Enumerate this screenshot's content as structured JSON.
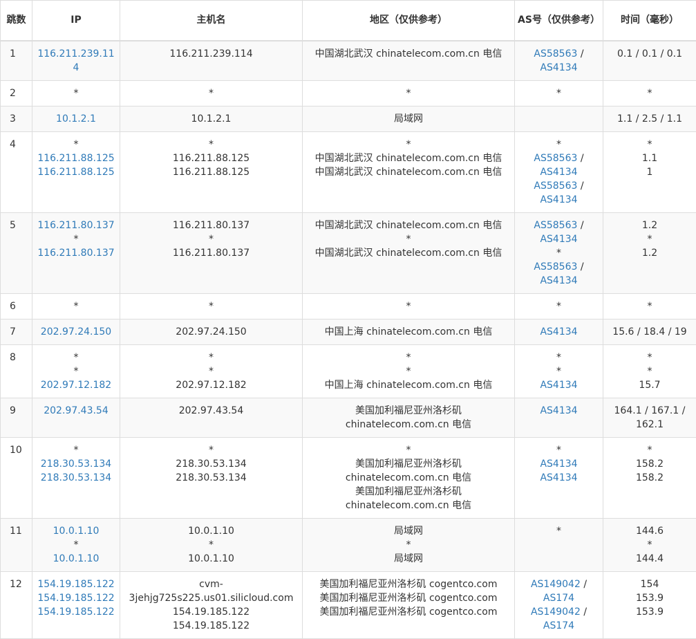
{
  "headers": [
    "跳数",
    "IP",
    "主机名",
    "地区（仅供参考）",
    "AS号（仅供参考）",
    "时间（毫秒）"
  ],
  "rows": [
    {
      "hop": "1",
      "ips": [
        "116.211.239.114"
      ],
      "hosts": [
        "116.211.239.114"
      ],
      "regions": [
        "中国湖北武汉 chinatelecom.com.cn 电信"
      ],
      "as": [
        [
          "AS58563",
          "AS4134"
        ]
      ],
      "times": [
        "0.1 / 0.1 / 0.1"
      ]
    },
    {
      "hop": "2",
      "ips": [
        "*"
      ],
      "hosts": [
        "*"
      ],
      "regions": [
        "*"
      ],
      "as": [
        [
          "*"
        ]
      ],
      "times": [
        "*"
      ]
    },
    {
      "hop": "3",
      "ips": [
        "10.1.2.1"
      ],
      "hosts": [
        "10.1.2.1"
      ],
      "regions": [
        "局域网"
      ],
      "as": [],
      "times": [
        "1.1 / 2.5 / 1.1"
      ]
    },
    {
      "hop": "4",
      "ips": [
        "*",
        "116.211.88.125",
        "116.211.88.125"
      ],
      "hosts": [
        "*",
        "116.211.88.125",
        "116.211.88.125"
      ],
      "regions": [
        "*",
        "中国湖北武汉 chinatelecom.com.cn 电信",
        "中国湖北武汉 chinatelecom.com.cn 电信"
      ],
      "as": [
        [
          "*"
        ],
        [
          "AS58563",
          "AS4134"
        ],
        [
          "AS58563",
          "AS4134"
        ]
      ],
      "times": [
        "*",
        "1.1",
        "1"
      ]
    },
    {
      "hop": "5",
      "ips": [
        "116.211.80.137",
        "*",
        "116.211.80.137"
      ],
      "hosts": [
        "116.211.80.137",
        "*",
        "116.211.80.137"
      ],
      "regions": [
        "中国湖北武汉 chinatelecom.com.cn 电信",
        "*",
        "中国湖北武汉 chinatelecom.com.cn 电信"
      ],
      "as": [
        [
          "AS58563",
          "AS4134"
        ],
        [
          "*"
        ],
        [
          "AS58563",
          "AS4134"
        ]
      ],
      "times": [
        "1.2",
        "*",
        "1.2"
      ]
    },
    {
      "hop": "6",
      "ips": [
        "*"
      ],
      "hosts": [
        "*"
      ],
      "regions": [
        "*"
      ],
      "as": [
        [
          "*"
        ]
      ],
      "times": [
        "*"
      ]
    },
    {
      "hop": "7",
      "ips": [
        "202.97.24.150"
      ],
      "hosts": [
        "202.97.24.150"
      ],
      "regions": [
        "中国上海 chinatelecom.com.cn 电信"
      ],
      "as": [
        [
          "AS4134"
        ]
      ],
      "times": [
        "15.6 / 18.4 / 19"
      ]
    },
    {
      "hop": "8",
      "ips": [
        "*",
        "*",
        "202.97.12.182"
      ],
      "hosts": [
        "*",
        "*",
        "202.97.12.182"
      ],
      "regions": [
        "*",
        "*",
        "中国上海 chinatelecom.com.cn 电信"
      ],
      "as": [
        [
          "*"
        ],
        [
          "*"
        ],
        [
          "AS4134"
        ]
      ],
      "times": [
        "*",
        "*",
        "15.7"
      ]
    },
    {
      "hop": "9",
      "ips": [
        "202.97.43.54"
      ],
      "hosts": [
        "202.97.43.54"
      ],
      "regions": [
        "美国加利福尼亚州洛杉矶 chinatelecom.com.cn 电信"
      ],
      "as": [
        [
          "AS4134"
        ]
      ],
      "times": [
        "164.1 / 167.1 / 162.1"
      ]
    },
    {
      "hop": "10",
      "ips": [
        "*",
        "218.30.53.134",
        "218.30.53.134"
      ],
      "hosts": [
        "*",
        "218.30.53.134",
        "218.30.53.134"
      ],
      "regions": [
        "*",
        "美国加利福尼亚州洛杉矶 chinatelecom.com.cn 电信",
        "美国加利福尼亚州洛杉矶 chinatelecom.com.cn 电信"
      ],
      "as": [
        [
          "*"
        ],
        [
          "AS4134"
        ],
        [
          "AS4134"
        ]
      ],
      "times": [
        "*",
        "158.2",
        "158.2"
      ]
    },
    {
      "hop": "11",
      "ips": [
        "10.0.1.10",
        "*",
        "10.0.1.10"
      ],
      "hosts": [
        "10.0.1.10",
        "*",
        "10.0.1.10"
      ],
      "regions": [
        "局域网",
        "*",
        "局域网"
      ],
      "as": [
        [
          "*"
        ]
      ],
      "times": [
        "144.6",
        "*",
        "144.4"
      ]
    },
    {
      "hop": "12",
      "ips": [
        "154.19.185.122",
        "154.19.185.122",
        "154.19.185.122"
      ],
      "hosts": [
        "cvm-3jehjg725s225.us01.silicloud.com",
        "154.19.185.122",
        "154.19.185.122"
      ],
      "regions": [
        "美国加利福尼亚州洛杉矶 cogentco.com",
        "美国加利福尼亚州洛杉矶 cogentco.com",
        "美国加利福尼亚州洛杉矶 cogentco.com"
      ],
      "as": [
        [
          "AS149042",
          "AS174"
        ],
        [
          "AS149042",
          "AS174"
        ]
      ],
      "times": [
        "154",
        "153.9",
        "153.9"
      ]
    }
  ]
}
